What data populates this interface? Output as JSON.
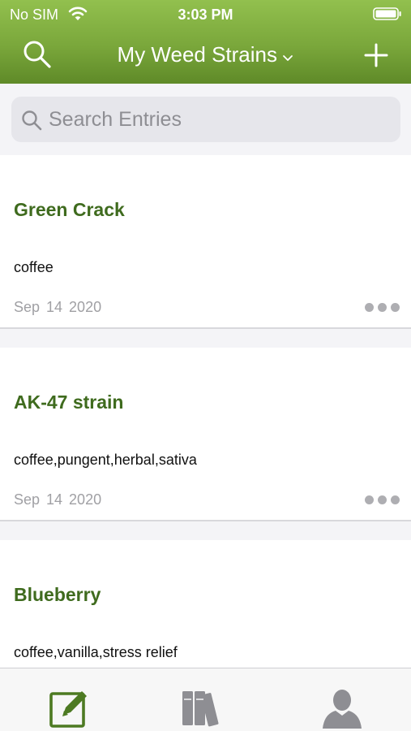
{
  "status_bar": {
    "carrier": "No SIM",
    "time": "3:03 PM"
  },
  "nav": {
    "title": "My Weed Strains",
    "left_icon": "search-icon",
    "right_icon": "plus-icon"
  },
  "search": {
    "placeholder": "Search Entries"
  },
  "entries": [
    {
      "title": "Green Crack",
      "tags": "coffee",
      "date": "Sep 14  2020"
    },
    {
      "title": "AK-47 strain",
      "tags": "coffee,pungent,herbal,sativa",
      "date": "Sep 14  2020"
    },
    {
      "title": "Blueberry",
      "tags": "coffee,vanilla,stress relief"
    }
  ],
  "tabs": [
    {
      "icon": "edit-icon",
      "active": true
    },
    {
      "icon": "library-icon",
      "active": false
    },
    {
      "icon": "profile-icon",
      "active": false
    }
  ],
  "colors": {
    "header_top": "#92c04e",
    "header_bottom": "#5f8a28",
    "title_green": "#3f6b1e",
    "tab_active": "#4d7a22",
    "tab_inactive": "#8e8e93"
  }
}
